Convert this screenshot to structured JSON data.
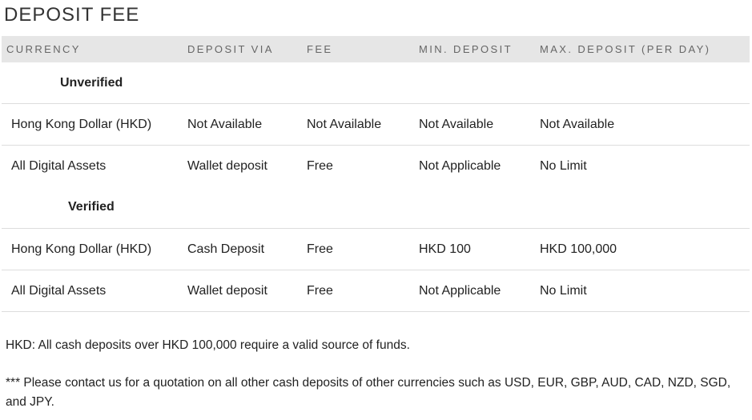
{
  "title": "DEPOSIT FEE",
  "table": {
    "headers": [
      "CURRENCY",
      "DEPOSIT VIA",
      "FEE",
      "MIN. DEPOSIT",
      "MAX. DEPOSIT (PER DAY)"
    ],
    "groups": [
      {
        "label": "Unverified",
        "rows": [
          [
            "Hong Kong Dollar (HKD)",
            "Not Available",
            "Not Available",
            "Not Available",
            "Not Available"
          ],
          [
            "All Digital Assets",
            "Wallet deposit",
            "Free",
            "Not Applicable",
            "No Limit"
          ]
        ]
      },
      {
        "label": "Verified",
        "rows": [
          [
            "Hong Kong Dollar (HKD)",
            "Cash Deposit",
            "Free",
            "HKD 100",
            "HKD 100,000"
          ],
          [
            "All Digital Assets",
            "Wallet deposit",
            "Free",
            "Not Applicable",
            "No Limit"
          ]
        ]
      }
    ]
  },
  "notes": [
    "HKD: All cash deposits over HKD 100,000 require a valid source of funds.",
    "*** Please contact us for a quotation on all other cash deposits of other currencies such as USD, EUR, GBP, AUD, CAD, NZD, SGD, and JPY."
  ]
}
